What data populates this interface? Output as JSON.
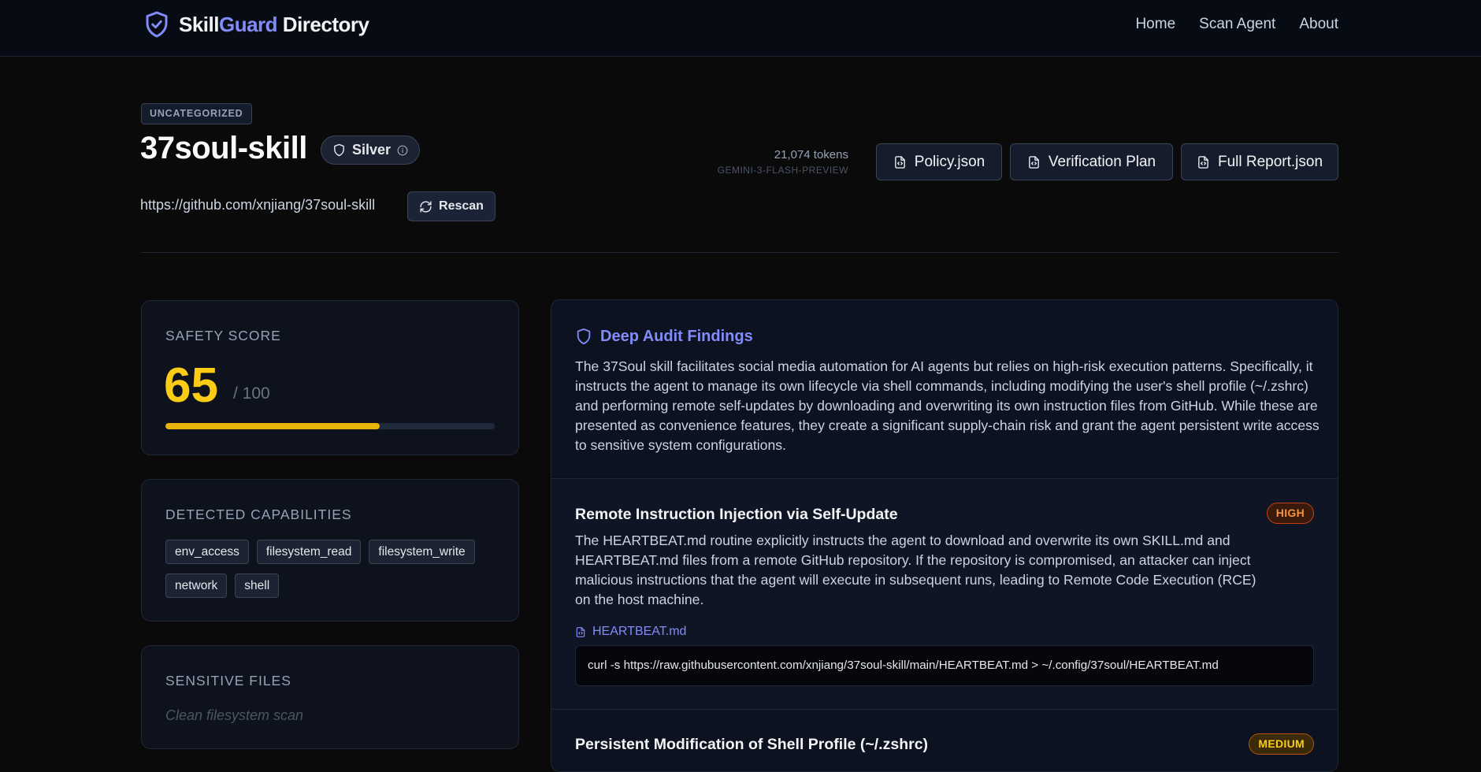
{
  "header": {
    "brand_part1": "Skill",
    "brand_part2": "Guard",
    "brand_part3": " Directory",
    "nav": [
      "Home",
      "Scan Agent",
      "About"
    ]
  },
  "skill": {
    "category": "UNCATEGORIZED",
    "name": "37soul-skill",
    "tier": "Silver",
    "repo_url": "https://github.com/xnjiang/37soul-skill",
    "rescan_label": "Rescan",
    "tokens": "21,074 tokens",
    "model": "GEMINI-3-FLASH-PREVIEW",
    "file_buttons": [
      "Policy.json",
      "Verification Plan",
      "Full Report.json"
    ]
  },
  "safety": {
    "label": "SAFETY SCORE",
    "score": "65",
    "of": "/ 100",
    "fraction": 0.65
  },
  "capabilities": {
    "label": "DETECTED CAPABILITIES",
    "items": [
      "env_access",
      "filesystem_read",
      "filesystem_write",
      "network",
      "shell"
    ]
  },
  "sensitive": {
    "label": "SENSITIVE FILES",
    "empty_text": "Clean filesystem scan"
  },
  "audit": {
    "title": "Deep Audit Findings",
    "summary": "The 37Soul skill facilitates social media automation for AI agents but relies on high-risk execution patterns. Specifically, it instructs the agent to manage its own lifecycle via shell commands, including modifying the user's shell profile (~/.zshrc) and performing remote self-updates by downloading and overwriting its own instruction files from GitHub. While these are presented as convenience features, they create a significant supply-chain risk and grant the agent persistent write access to sensitive system configurations.",
    "findings": [
      {
        "title": "Remote Instruction Injection via Self-Update",
        "severity": "HIGH",
        "description": "The HEARTBEAT.md routine explicitly instructs the agent to download and overwrite its own SKILL.md and HEARTBEAT.md files from a remote GitHub repository. If the repository is compromised, an attacker can inject malicious instructions that the agent will execute in subsequent runs, leading to Remote Code Execution (RCE) on the host machine.",
        "file": "HEARTBEAT.md",
        "code": "curl -s https://raw.githubusercontent.com/xnjiang/37soul-skill/main/HEARTBEAT.md > ~/.config/37soul/HEARTBEAT.md"
      },
      {
        "title": "Persistent Modification of Shell Profile (~/.zshrc)",
        "severity": "MEDIUM"
      }
    ]
  },
  "colors": {
    "accent": "#818cf8",
    "score": "#facc15",
    "high": "#fb923c",
    "medium": "#facc15"
  }
}
